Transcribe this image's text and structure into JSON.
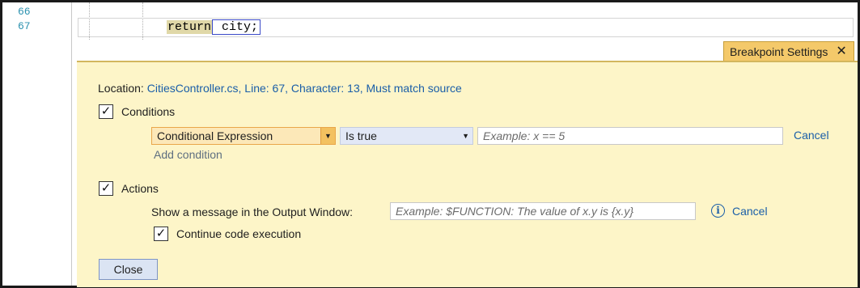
{
  "editor": {
    "line_numbers": [
      "66",
      "67"
    ],
    "code_keyword": "return",
    "code_text": " city;"
  },
  "breakpoint_tab": {
    "title": "Breakpoint Settings",
    "close_glyph": "✕"
  },
  "settings": {
    "location_label": "Location:",
    "location_value": "CitiesController.cs, Line: 67, Character: 13, Must match source",
    "conditions": {
      "checked": true,
      "label": "Conditions",
      "type_selected": "Conditional Expression",
      "mode_selected": "Is true",
      "expression_placeholder": "Example: x == 5",
      "cancel_label": "Cancel",
      "add_condition_label": "Add condition"
    },
    "actions": {
      "checked": true,
      "label": "Actions",
      "message_label": "Show a message in the Output Window:",
      "message_placeholder": "Example: $FUNCTION: The value of x.y is {x.y}",
      "info_glyph": "i",
      "cancel_label": "Cancel",
      "continue_checked": true,
      "continue_label": "Continue code execution"
    },
    "check_glyph": "✓",
    "dropdown_glyph": "▼",
    "close_button_label": "Close"
  },
  "colors": {
    "panel_background": "#fdf5c8",
    "tab_background": "#f4c96a",
    "link": "#1a5ea8",
    "line_number": "#2b91af"
  }
}
